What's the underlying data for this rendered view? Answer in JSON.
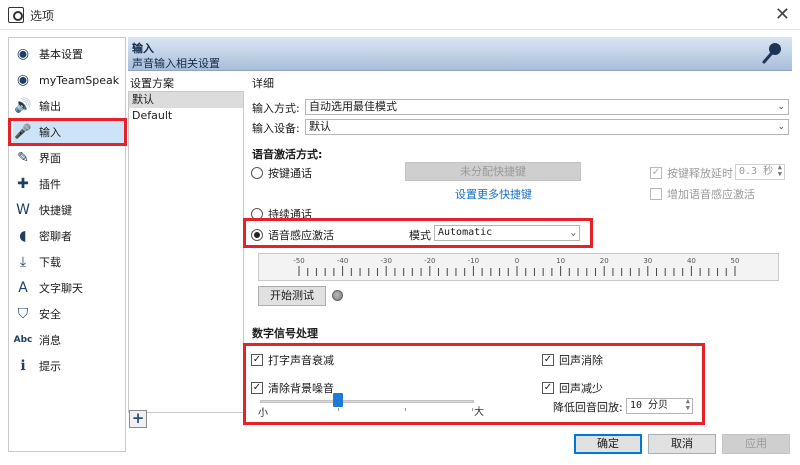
{
  "window": {
    "title": "选项",
    "close_glyph": "✕"
  },
  "sidebar": {
    "items": [
      {
        "label": "基本设置",
        "icon": "general-settings-icon",
        "glyph": "◉"
      },
      {
        "label": "myTeamSpeak",
        "icon": "myteamspeak-icon",
        "glyph": "◉"
      },
      {
        "label": "输出",
        "icon": "speaker-icon",
        "glyph": "🔊"
      },
      {
        "label": "输入",
        "icon": "microphone-icon",
        "glyph": "🎤"
      },
      {
        "label": "界面",
        "icon": "interface-icon",
        "glyph": "✎"
      },
      {
        "label": "插件",
        "icon": "plugin-icon",
        "glyph": "✚"
      },
      {
        "label": "快捷键",
        "icon": "hotkey-icon",
        "glyph": "W"
      },
      {
        "label": "密聊者",
        "icon": "whisper-icon",
        "glyph": "◖"
      },
      {
        "label": "下载",
        "icon": "download-icon",
        "glyph": "⤓"
      },
      {
        "label": "文字聊天",
        "icon": "text-chat-icon",
        "glyph": "A"
      },
      {
        "label": "安全",
        "icon": "security-icon",
        "glyph": "⛉"
      },
      {
        "label": "消息",
        "icon": "messages-icon",
        "glyph": "Abc"
      },
      {
        "label": "提示",
        "icon": "notifications-icon",
        "glyph": "ℹ"
      }
    ],
    "active_index": 3
  },
  "header": {
    "title": "输入",
    "subtitle": "声音输入相关设置",
    "icon": "microphone-icon"
  },
  "profiles": {
    "label": "设置方案",
    "items": [
      "默认",
      "Default"
    ],
    "selected_index": 0,
    "add_glyph": "+"
  },
  "details": {
    "label": "详细",
    "input_mode": {
      "label": "输入方式:",
      "value": "自动选用最佳模式"
    },
    "input_device": {
      "label": "输入设备:",
      "value": "默认"
    },
    "activation": {
      "title": "语音激活方式:",
      "ptt_label": "按键通话",
      "hotkey_button": "未分配快捷键",
      "more_hotkeys_link": "设置更多快捷键",
      "release_delay_label": "按键释放延时",
      "release_delay_value": "0.3 秒",
      "add_vad_label": "增加语音感应激活",
      "continuous_label": "持续通话",
      "vad_label": "语音感应激活",
      "mode_label": "模式",
      "mode_value": "Automatic",
      "selected": "vad"
    },
    "meter": {
      "tick_labels": [
        "-50",
        "-40",
        "-30",
        "-20",
        "-10",
        "0",
        "10",
        "20",
        "30",
        "40",
        "50"
      ]
    },
    "test_button": "开始测试",
    "dsp": {
      "title": "数字信号处理",
      "typing_attenuation": {
        "label": "打字声音衰减",
        "checked": true
      },
      "remove_background_noise": {
        "label": "清除背景噪音",
        "checked": true
      },
      "echo_cancellation": {
        "label": "回声消除",
        "checked": true
      },
      "echo_reduction": {
        "label": "回声减少",
        "checked": true
      },
      "echo_reduction_playback_label": "降低回音回放:",
      "echo_reduction_playback_value": "10 分贝",
      "slider_min_label": "小",
      "slider_max_label": "大"
    }
  },
  "footer": {
    "ok": "确定",
    "cancel": "取消",
    "apply": "应用"
  }
}
